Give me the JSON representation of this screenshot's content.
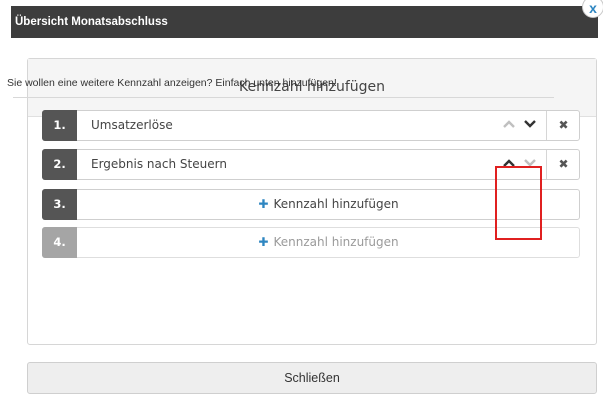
{
  "header": {
    "title": "Übersicht Monatsabschluss",
    "close_glyph": "x"
  },
  "panel": {
    "title": "Kennzahl hinzufügen",
    "instruction": "Sie wollen eine weitere Kennzahl anzeigen? Einfach unten hinzufügen!",
    "rows": [
      {
        "number": "1.",
        "label": "Umsatzerlöse",
        "up_enabled": false,
        "down_enabled": true
      },
      {
        "number": "2.",
        "label": "Ergebnis nach Steuern",
        "up_enabled": true,
        "down_enabled": false
      },
      {
        "number": "3.",
        "add_label": "Kennzahl hinzufügen",
        "enabled": true
      },
      {
        "number": "4.",
        "add_label": "Kennzahl hinzufügen",
        "enabled": false
      }
    ],
    "icons": {
      "up": "^",
      "down": "v",
      "delete": "✖",
      "plus": "✚"
    }
  },
  "footer": {
    "close_label": "Schließen"
  },
  "colors": {
    "header_bg": "#3d3d3d",
    "accent": "#2e86c1",
    "highlight": "#e02020"
  }
}
